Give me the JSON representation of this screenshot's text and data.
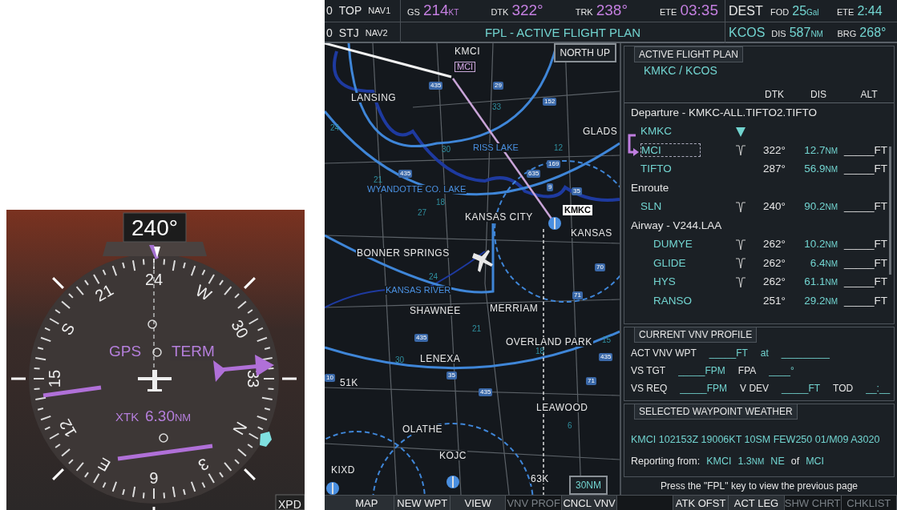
{
  "hsi": {
    "heading": "240°",
    "compass_labels": [
      "24",
      "21",
      "S",
      "15",
      "12",
      "E",
      "6",
      "3",
      "N",
      "33",
      "30",
      "W"
    ],
    "nav_source": "GPS",
    "flight_phase": "TERM",
    "xtk_label": "XTK",
    "xtk_value": "6.30",
    "xtk_unit": "NM",
    "transponder_tab": "XPD"
  },
  "top_bar": {
    "nav": [
      {
        "freq": "0",
        "id": "TOP",
        "radio": "NAV1"
      },
      {
        "freq": "0",
        "id": "STJ",
        "radio": "NAV2"
      }
    ],
    "fields": [
      {
        "label": "GS",
        "value": "214",
        "unit": "KT"
      },
      {
        "label": "DTK",
        "value": "322°"
      },
      {
        "label": "TRK",
        "value": "238°"
      },
      {
        "label": "ETE",
        "value": "03:35"
      }
    ],
    "page_title": "FPL - ACTIVE FLIGHT PLAN",
    "dest_label": "DEST",
    "dest": "KCOS",
    "dest_fields": [
      {
        "label": "FOD",
        "value": "25",
        "unit": "Gal"
      },
      {
        "label": "ETE",
        "value": "2:44"
      },
      {
        "label": "DIS",
        "value": "587",
        "unit": "NM"
      },
      {
        "label": "BRG",
        "value": "268°"
      }
    ]
  },
  "map": {
    "orientation": "NORTH UP",
    "range": "30NM",
    "labels": [
      {
        "text": "KMCI",
        "kind": "place"
      },
      {
        "text": "MCI",
        "kind": "waypoint"
      },
      {
        "text": "LANSING",
        "kind": "place"
      },
      {
        "text": "GLADS",
        "kind": "place"
      },
      {
        "text": "RISS LAKE",
        "kind": "water"
      },
      {
        "text": "WYANDOTTE CO. LAKE",
        "kind": "water"
      },
      {
        "text": "KANSAS CITY",
        "kind": "place"
      },
      {
        "text": "KMKC",
        "kind": "selected"
      },
      {
        "text": "KANSAS",
        "kind": "place"
      },
      {
        "text": "BONNER SPRINGS",
        "kind": "place"
      },
      {
        "text": "KANSAS RIVER",
        "kind": "water"
      },
      {
        "text": "SHAWNEE",
        "kind": "place"
      },
      {
        "text": "MERRIAM",
        "kind": "place"
      },
      {
        "text": "OVERLAND PARK",
        "kind": "place"
      },
      {
        "text": "LENEXA",
        "kind": "place"
      },
      {
        "text": "51K",
        "kind": "place"
      },
      {
        "text": "OLATHE",
        "kind": "place"
      },
      {
        "text": "LEAWOOD",
        "kind": "place"
      },
      {
        "text": "KOJC",
        "kind": "place"
      },
      {
        "text": "KIXD",
        "kind": "place"
      },
      {
        "text": "63K",
        "kind": "place"
      },
      {
        "text": "435",
        "kind": "shield"
      },
      {
        "text": "29",
        "kind": "shield"
      },
      {
        "text": "152",
        "kind": "shield"
      },
      {
        "text": "435",
        "kind": "shield"
      },
      {
        "text": "635",
        "kind": "shield"
      },
      {
        "text": "169",
        "kind": "shield"
      },
      {
        "text": "9",
        "kind": "shield"
      },
      {
        "text": "35",
        "kind": "shield"
      },
      {
        "text": "70",
        "kind": "shield"
      },
      {
        "text": "71",
        "kind": "shield"
      },
      {
        "text": "435",
        "kind": "shield"
      },
      {
        "text": "35",
        "kind": "shield"
      },
      {
        "text": "435",
        "kind": "shield"
      },
      {
        "text": "435",
        "kind": "shield"
      },
      {
        "text": "71",
        "kind": "shield"
      },
      {
        "text": "10",
        "kind": "shield"
      },
      {
        "text": "30",
        "kind": "number"
      },
      {
        "text": "33",
        "kind": "number"
      },
      {
        "text": "21",
        "kind": "number"
      },
      {
        "text": "18",
        "kind": "number"
      },
      {
        "text": "27",
        "kind": "number"
      },
      {
        "text": "24",
        "kind": "number"
      },
      {
        "text": "12",
        "kind": "number"
      },
      {
        "text": "21",
        "kind": "number"
      },
      {
        "text": "18",
        "kind": "number"
      },
      {
        "text": "30",
        "kind": "number"
      },
      {
        "text": "15",
        "kind": "number"
      },
      {
        "text": "6",
        "kind": "number"
      },
      {
        "text": "24",
        "kind": "number"
      }
    ]
  },
  "flight_plan": {
    "title": "ACTIVE FLIGHT PLAN",
    "route": "KMKC / KCOS",
    "columns": [
      "DTK",
      "DIS",
      "ALT"
    ],
    "sections": [
      {
        "heading": "Departure - KMKC-ALL.TIFTO2.TIFTO",
        "kind": "procedure",
        "legs": [
          {
            "name": "KMKC",
            "kind": "vnav_target",
            "selected": false,
            "active": false
          },
          {
            "name": "MCI",
            "kind": "vnav",
            "dtk": "322°",
            "dis": "12.7",
            "dis_unit": "NM",
            "alt": "_____FT",
            "selected": true,
            "active": true
          },
          {
            "name": "TIFTO",
            "kind": "plain",
            "dtk": "287°",
            "dis": "56.9",
            "dis_unit": "NM",
            "alt": "_____FT",
            "selected": false,
            "active": false
          }
        ]
      },
      {
        "heading": "Enroute",
        "kind": "procedure",
        "legs": [
          {
            "name": "SLN",
            "kind": "vnav",
            "dtk": "240°",
            "dis": "90.2",
            "dis_unit": "NM",
            "alt": "_____FT",
            "selected": false,
            "active": false
          }
        ]
      },
      {
        "heading": "Airway - V244.LAA",
        "kind": "airway",
        "legs": [
          {
            "name": "DUMYE",
            "kind": "vnav",
            "dtk": "262°",
            "dis": "10.2",
            "dis_unit": "NM",
            "alt": "_____FT",
            "selected": false,
            "active": false
          },
          {
            "name": "GLIDE",
            "kind": "vnav",
            "dtk": "262°",
            "dis": "6.4",
            "dis_unit": "NM",
            "alt": "_____FT",
            "selected": false,
            "active": false
          },
          {
            "name": "HYS",
            "kind": "vnav",
            "dtk": "262°",
            "dis": "61.1",
            "dis_unit": "NM",
            "alt": "_____FT",
            "selected": false,
            "active": false
          },
          {
            "name": "RANSO",
            "kind": "plain",
            "dtk": "251°",
            "dis": "29.2",
            "dis_unit": "NM",
            "alt": "_____FT",
            "selected": false,
            "active": false
          }
        ]
      }
    ]
  },
  "vnv_profile": {
    "title": "CURRENT VNV PROFILE",
    "lines": [
      [
        {
          "text": "ACT VNV WPT",
          "kind": "label"
        },
        {
          "text": "_____FT",
          "kind": "value"
        },
        {
          "text": "at",
          "kind": "value"
        },
        {
          "text": "_________",
          "kind": "value"
        }
      ],
      [
        {
          "text": "VS TGT",
          "kind": "label"
        },
        {
          "text": "_____FPM",
          "kind": "value"
        },
        {
          "text": "FPA",
          "kind": "label"
        },
        {
          "text": "____°",
          "kind": "value"
        }
      ],
      [
        {
          "text": "VS REQ",
          "kind": "label"
        },
        {
          "text": "_____FPM",
          "kind": "value"
        },
        {
          "text": "V DEV",
          "kind": "label"
        },
        {
          "text": "_____FT",
          "kind": "value"
        },
        {
          "text": "TOD",
          "kind": "label"
        },
        {
          "text": "__:__",
          "kind": "value"
        }
      ]
    ]
  },
  "waypoint_weather": {
    "title": "SELECTED WAYPOINT WEATHER",
    "metar": "KMCI 102153Z 19006KT 10SM FEW250 01/M09 A3020",
    "reporting": [
      {
        "text": "Reporting from:",
        "kind": "label"
      },
      {
        "text": "KMCI",
        "kind": "value"
      },
      {
        "text": "1.3",
        "unit": "NM",
        "kind": "value"
      },
      {
        "text": "NE",
        "kind": "value"
      },
      {
        "text": "of",
        "kind": "label"
      },
      {
        "text": "MCI",
        "kind": "value"
      }
    ]
  },
  "message": "Press the \"FPL\" key to view the previous page",
  "softkeys": [
    {
      "label": "MAP",
      "disabled": false
    },
    {
      "label": "NEW WPT",
      "disabled": false
    },
    {
      "label": "VIEW",
      "disabled": false
    },
    {
      "label": "VNV PROF",
      "disabled": true
    },
    {
      "label": "CNCL VNV",
      "disabled": false
    },
    {
      "disabled": true
    },
    {
      "label": "ATK OFST",
      "disabled": false
    },
    {
      "label": "ACT LEG",
      "disabled": false
    },
    {
      "label": "SHW CHRT",
      "disabled": true
    },
    {
      "label": "CHKLIST",
      "disabled": true
    }
  ]
}
